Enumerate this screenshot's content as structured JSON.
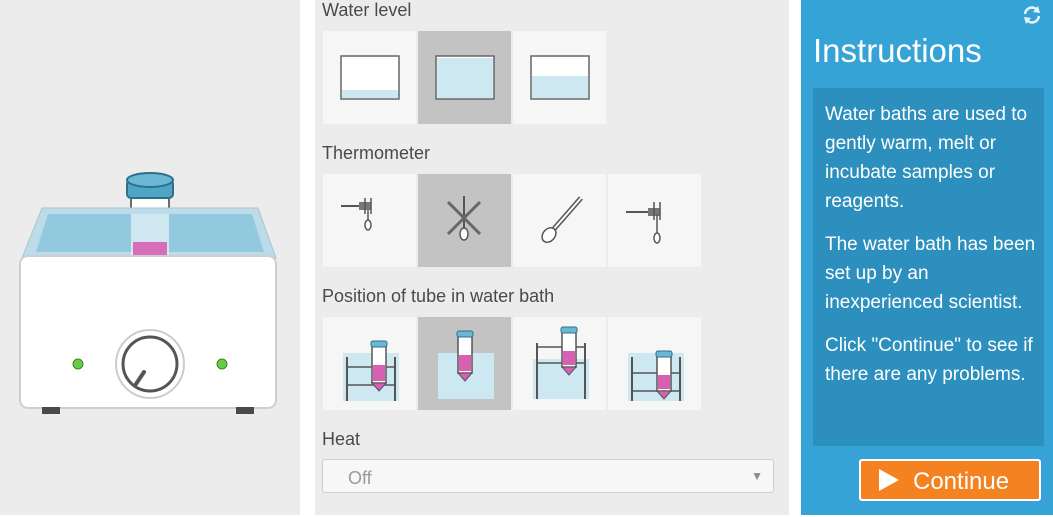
{
  "sections": {
    "water_level": {
      "title": "Water level",
      "options": [
        "low",
        "medium",
        "high"
      ],
      "selected": 1
    },
    "thermometer": {
      "title": "Thermometer",
      "options": [
        "thermometer-clamped-short",
        "no-thermometer",
        "thermometer-loose",
        "thermometer-clamped-deep"
      ],
      "selected": 1
    },
    "tube_position": {
      "title": "Position of tube in water bath",
      "options": [
        "tube-in-rack-high",
        "tube-floating",
        "tube-raised-above-rack",
        "tube-in-rack-low"
      ],
      "selected": 1
    },
    "heat": {
      "title": "Heat",
      "value": "Off"
    }
  },
  "instructions": {
    "title": "Instructions",
    "paragraphs": [
      "Water baths are used to gently warm, melt or incubate samples or reagents.",
      "The water bath has been set up by an inexperienced scientist.",
      "Click \"Continue\" to see if there are any problems."
    ]
  },
  "continue_label": "Continue",
  "icons": {
    "refresh": "refresh-icon",
    "play": "play-icon",
    "dropdown": "chevron-down-icon"
  },
  "colors": {
    "accent_blue": "#35a3d5",
    "instruction_box": "#2c8fbd",
    "continue_orange": "#f58220",
    "water": "#cde8f0",
    "sample_pink": "#d85fb2"
  }
}
